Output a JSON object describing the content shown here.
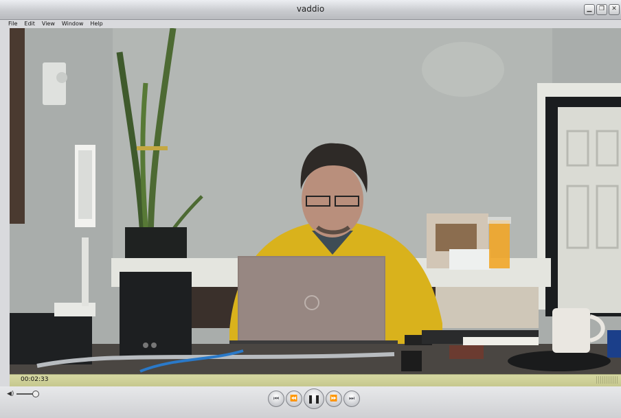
{
  "window": {
    "title": "vaddio",
    "buttons": [
      "minimize-icon",
      "restore-icon",
      "close-icon"
    ]
  },
  "menu": {
    "items": [
      "File",
      "Edit",
      "View",
      "Window",
      "Help"
    ]
  },
  "player": {
    "timecode": "00:02:33",
    "volume_icon": "speaker-icon",
    "volume_level": 0.9,
    "controls": [
      "skip-back-icon",
      "rewind-icon",
      "pause-icon",
      "fast-forward-icon",
      "skip-forward-icon"
    ],
    "state": "playing"
  },
  "colors": {
    "timebar": "#d2d49a",
    "chrome": "#d9dadd",
    "accent_shirt": "#d9b21c"
  }
}
